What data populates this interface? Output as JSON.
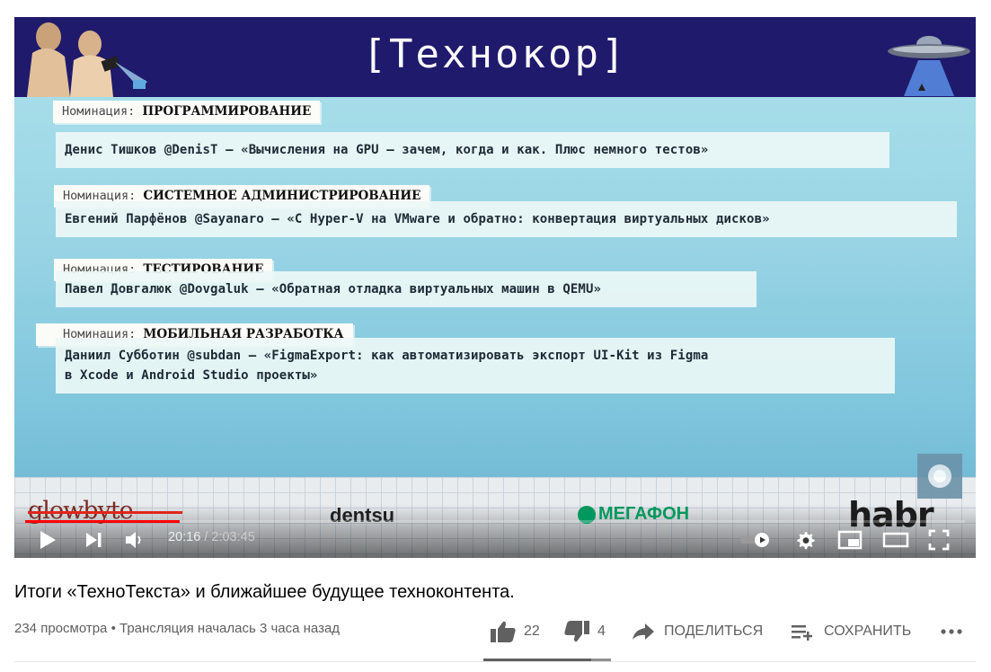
{
  "slide": {
    "title": "[Технокор]",
    "nominations": [
      {
        "label_prefix": "Номинация:",
        "category": "ПРОГРАММИРОВАНИЕ",
        "lines": [
          "Денис Тишков @DenisT — «Вычисления на GPU – зачем, когда и как. Плюс немного тестов»"
        ]
      },
      {
        "label_prefix": "Номинация:",
        "category": "СИСТЕМНОЕ АДМИНИСТРИРОВАНИЕ",
        "lines": [
          "Евгений Парфёнов @Sayanaro — «С Hyper-V на VMware и обратно: конвертация виртуальных дисков»"
        ]
      },
      {
        "label_prefix": "Номинация:",
        "category": "ТЕСТИРОВАНИЕ",
        "lines": [
          "Павел Довгалюк @Dovgaluk — «Обратная отладка виртуальных машин в QEMU»"
        ]
      },
      {
        "label_prefix": "Номинация:",
        "category": "МОБИЛЬНАЯ РАЗРАБОТКА",
        "lines": [
          "Даниил Субботин @subdan — «FigmaExport: как автоматизировать экспорт UI-Kit из Figma",
          "в Xcode и Android Studio проекты»"
        ]
      }
    ],
    "sponsors": {
      "glowbyte": "glowbyte",
      "dentsu": "dentsu",
      "megafon": "МЕГАФОН",
      "habr": "habr"
    }
  },
  "player": {
    "current_time": "20:16",
    "separator": "/",
    "duration": "2:03:45",
    "progress_fraction": 0.164,
    "icons": {
      "play": "play-icon",
      "next": "next-icon",
      "volume": "volume-icon",
      "autoplay": "autoplay-toggle",
      "settings": "gear-icon",
      "miniplayer": "miniplayer-icon",
      "theater": "theater-icon",
      "fullscreen": "fullscreen-icon"
    }
  },
  "video": {
    "title": "Итоги «ТехноТекста» и ближайшее будущее техноконтента.",
    "views": "234 просмотра",
    "meta_separator": "•",
    "stream_started": "Трансляция началась 3 часа назад"
  },
  "actions": {
    "likes": "22",
    "dislikes": "4",
    "share": "ПОДЕЛИТЬСЯ",
    "save": "СОХРАНИТЬ",
    "like_ratio": 0.846
  },
  "colors": {
    "slide_header": "#1f1a6b",
    "progress": "#ff0000",
    "megafon": "#00985f"
  }
}
